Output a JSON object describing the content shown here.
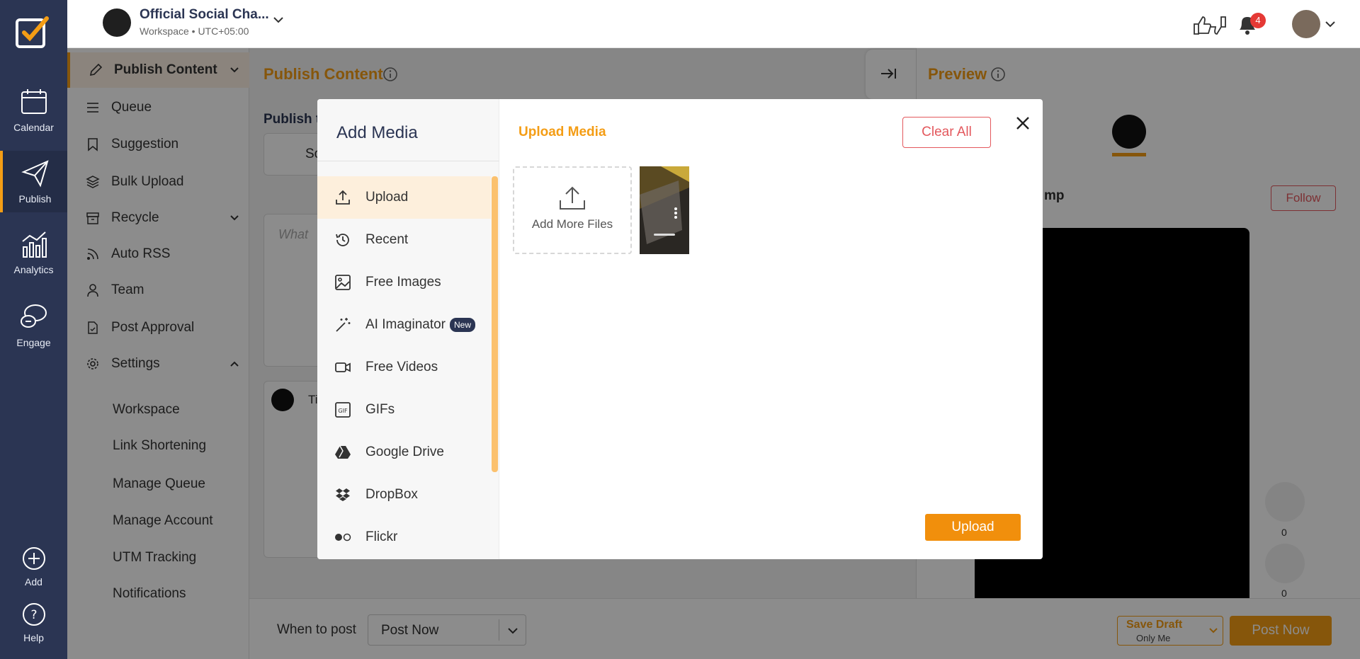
{
  "rail": {
    "items": [
      {
        "label": "Calendar"
      },
      {
        "label": "Publish"
      },
      {
        "label": "Analytics"
      },
      {
        "label": "Engage"
      },
      {
        "label": "Add"
      },
      {
        "label": "Help"
      }
    ]
  },
  "topbar": {
    "workspace_title": "Official Social Cha...",
    "workspace_sub": "Workspace • UTC+05:00",
    "notification_count": "4"
  },
  "subnav": {
    "items": [
      {
        "label": "Publish Content"
      },
      {
        "label": "Queue"
      },
      {
        "label": "Suggestion"
      },
      {
        "label": "Bulk Upload"
      },
      {
        "label": "Recycle"
      },
      {
        "label": "Auto RSS"
      },
      {
        "label": "Team"
      },
      {
        "label": "Post Approval"
      },
      {
        "label": "Settings"
      }
    ],
    "settings_items": [
      {
        "label": "Workspace"
      },
      {
        "label": "Link Shortening"
      },
      {
        "label": "Manage Queue"
      },
      {
        "label": "Manage Account"
      },
      {
        "label": "UTM Tracking"
      },
      {
        "label": "Notifications"
      }
    ]
  },
  "main": {
    "title": "Publish Content",
    "publish_to": "Publish t",
    "account_chip": "So",
    "composer_placeholder": "What",
    "tiktok_preview_label": "Ti"
  },
  "preview": {
    "title": "Preview",
    "username": "mp",
    "follow_label": "Follow",
    "likes": "0",
    "shares": "0"
  },
  "bottom": {
    "when_label": "When to post",
    "when_value": "Post Now",
    "save_draft": "Save Draft",
    "save_draft_sub": "Only Me",
    "post_now": "Post Now"
  },
  "modal": {
    "title": "Add Media",
    "header": "Upload Media",
    "clear_all": "Clear All",
    "add_more": "Add More Files",
    "upload_btn": "Upload",
    "new_badge": "New",
    "menu": [
      {
        "label": "Upload",
        "icon": "upload-icon"
      },
      {
        "label": "Recent",
        "icon": "history-icon"
      },
      {
        "label": "Free Images",
        "icon": "image-icon"
      },
      {
        "label": "AI Imaginator",
        "icon": "magic-wand-icon"
      },
      {
        "label": "Free Videos",
        "icon": "video-icon"
      },
      {
        "label": "GIFs",
        "icon": "gif-icon"
      },
      {
        "label": "Google Drive",
        "icon": "google-drive-icon"
      },
      {
        "label": "DropBox",
        "icon": "dropbox-icon"
      },
      {
        "label": "Flickr",
        "icon": "flickr-icon"
      }
    ]
  },
  "colors": {
    "accent": "#f49d15",
    "rail": "#2b3553",
    "danger": "#e3585d"
  }
}
